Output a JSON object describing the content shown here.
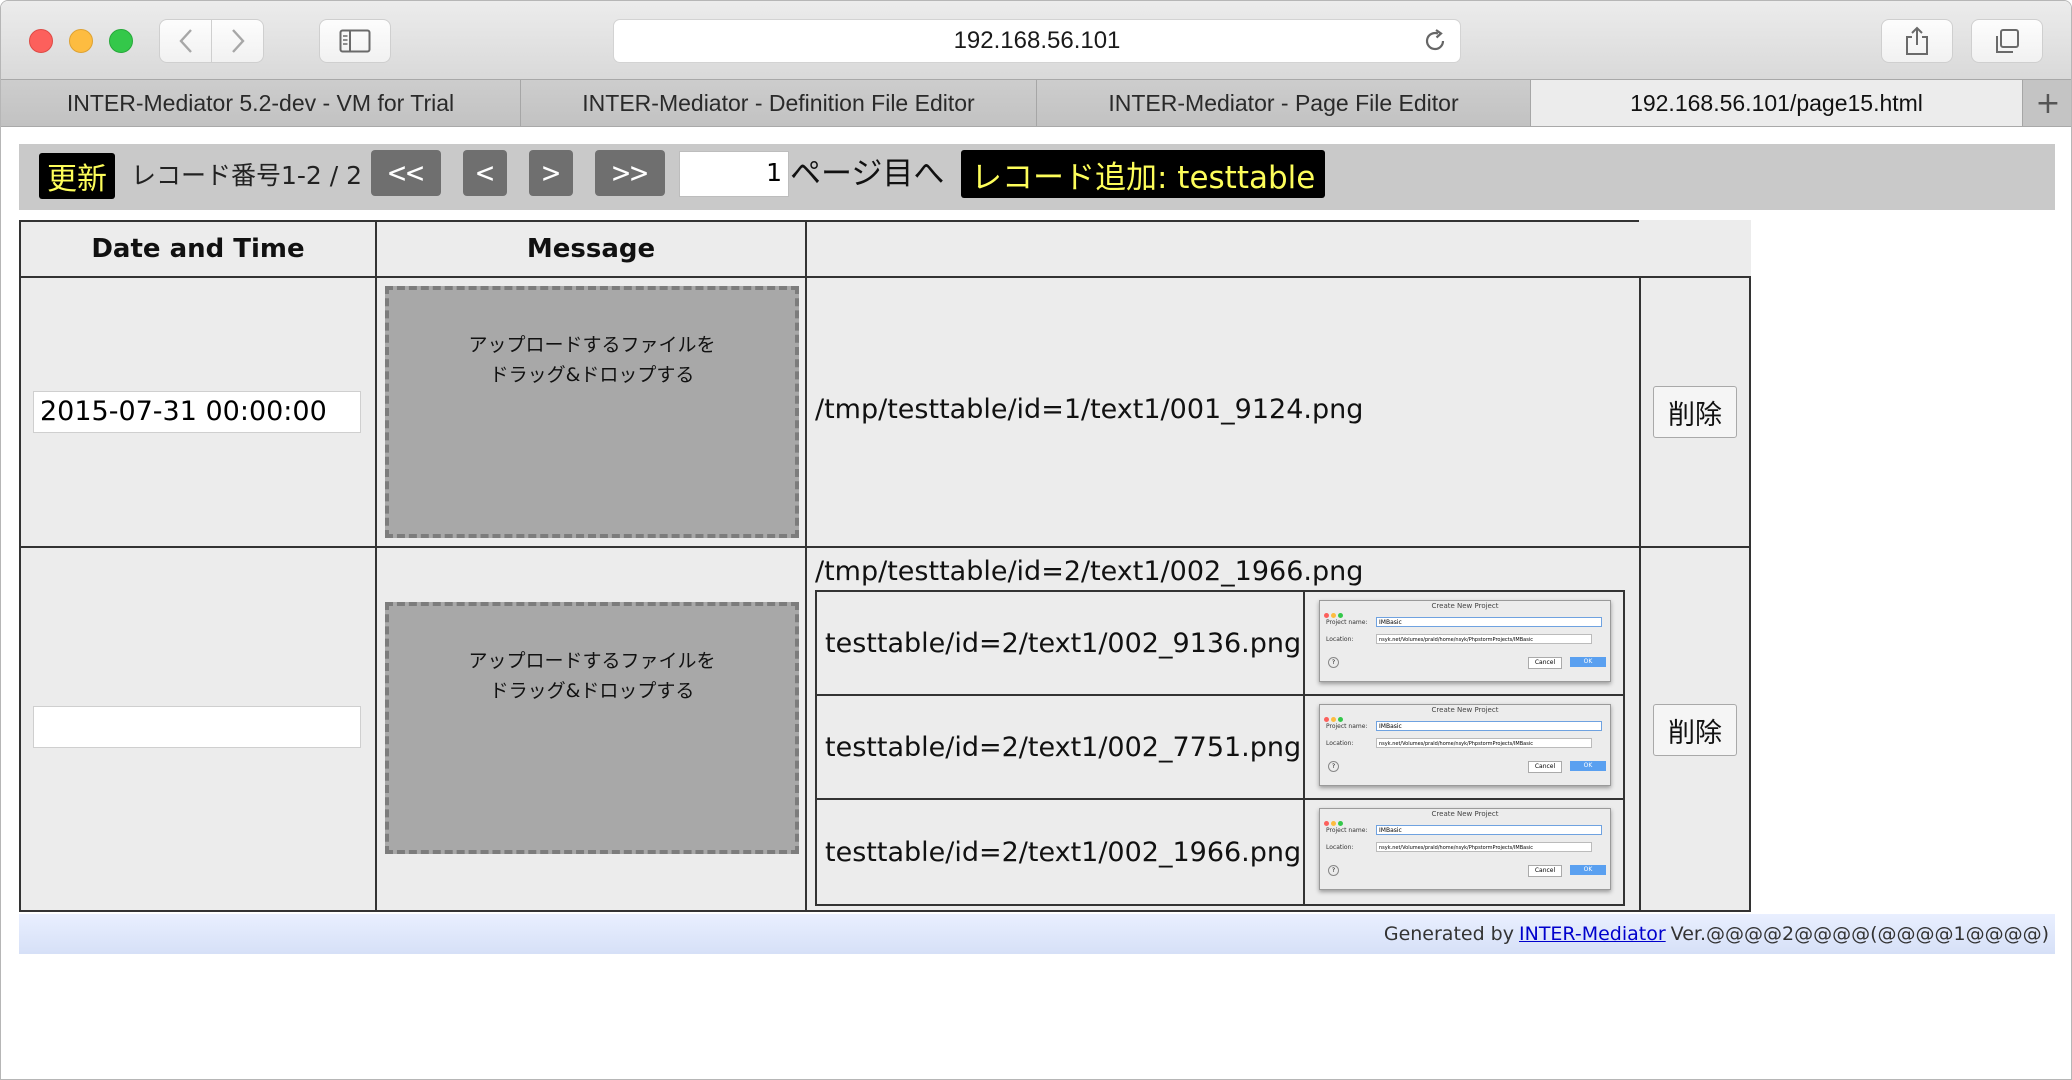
{
  "browser": {
    "url": "192.168.56.101",
    "tabs": [
      {
        "label": "INTER-Mediator 5.2-dev - VM for Trial"
      },
      {
        "label": "INTER-Mediator - Definition File Editor"
      },
      {
        "label": "INTER-Mediator - Page File Editor"
      },
      {
        "label": "192.168.56.101/page15.html",
        "active": true
      }
    ],
    "new_tab_label": "+"
  },
  "navigation": {
    "update_label": "更新",
    "record_info": "レコード番号1-2 / 2",
    "first_label": "<<",
    "prev_label": "<",
    "next_label": ">",
    "last_label": ">>",
    "page_value": "1",
    "page_suffix": "ページ目へ",
    "add_label": "レコード追加: testtable"
  },
  "table": {
    "headers": [
      "Date and Time",
      "Message",
      ""
    ],
    "drop_text_line1": "アップロードするファイルを",
    "drop_text_line2": "ドラッグ&ドロップする",
    "delete_label": "削除",
    "rows": [
      {
        "datetime": "2015-07-31 00:00:00",
        "path": "/tmp/testtable/id=1/text1/001_9124.png",
        "files": []
      },
      {
        "datetime": "",
        "path": "/tmp/testtable/id=2/text1/002_1966.png",
        "files": [
          {
            "name": "testtable/id=2/text1/002_9136.png"
          },
          {
            "name": "testtable/id=2/text1/002_7751.png"
          },
          {
            "name": "testtable/id=2/text1/002_1966.png"
          }
        ]
      }
    ]
  },
  "thumbnail_dialog": {
    "title": "Create New Project",
    "project_label": "Project name:",
    "project_value": "IMBasic",
    "location_label": "Location:",
    "location_value": "nsyk.net/Volumes/prald/home/nsyk/PhpstormProjects/IMBasic",
    "cancel_label": "Cancel",
    "ok_label": "OK",
    "help_label": "?"
  },
  "footer": {
    "prefix": "Generated by",
    "link": "INTER-Mediator",
    "suffix": "Ver.@@@@2@@@@(@@@@1@@@@)"
  },
  "colors": {
    "accent_button_text": "#fdfd5a",
    "footer_bg": "#dbe4fa",
    "link": "#0000cc"
  }
}
